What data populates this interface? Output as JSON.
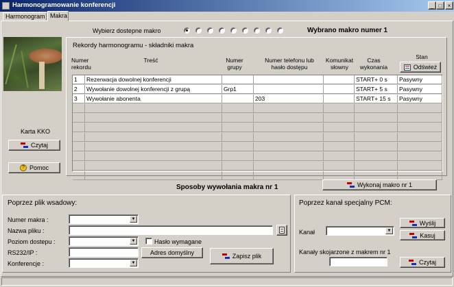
{
  "window": {
    "title": "Harmonogramowanie konferencji"
  },
  "tabs": [
    {
      "label": "Harmonogram"
    },
    {
      "label": "Makra"
    }
  ],
  "macro_select": {
    "label": "Wybierz dostepne makro",
    "radio_count": 9,
    "selected_index": 0,
    "status": "Wybrano makro numer 1"
  },
  "records": {
    "title": "Rekordy harmonogramu - składniki makra",
    "refresh_label": "Odśwież",
    "columns": {
      "num": "Numer rekordu",
      "content": "Treść",
      "group": "Numer grupy",
      "phone": "Numer telefonu lub hasło dostępu",
      "message": "Komunikat słowny",
      "time": "Czas wykonania",
      "state": "Stan"
    },
    "rows": [
      {
        "num": "1",
        "content": "Rezerwacja dowolnej konferencji",
        "group": "",
        "phone": "",
        "message": "",
        "time": "START+ 0 s",
        "state": "Pasywny"
      },
      {
        "num": "2",
        "content": "Wywołanie dowolnej konferencji z grupą",
        "group": "Grp1",
        "phone": "",
        "message": "",
        "time": "START+ 5 s",
        "state": "Pasywny"
      },
      {
        "num": "3",
        "content": "Wywołanie abonenta",
        "group": "",
        "phone": "203",
        "message": "",
        "time": "START+ 15 s",
        "state": "Pasywny"
      }
    ],
    "empty_rows": 8
  },
  "left": {
    "kko_label": "Karta KKO",
    "read_label": "Czytaj",
    "help_label": "Pomoc"
  },
  "methods_title": "Sposoby wywołania makra nr 1",
  "execute_label": "Wykonaj makro nr 1",
  "batch": {
    "title": "Poprzez plik wsadowy:",
    "macro_num_label": "Numer makra :",
    "file_label": "Nazwa pliku :",
    "access_label": "Poziom dostepu :",
    "password_label": "Hasło wymagane",
    "rs_label": "RS232/IP :",
    "default_addr_label": "Adres domyślny",
    "conf_label": "Konferencje :",
    "save_label": "Zapisz plik"
  },
  "pcm": {
    "title": "Poprzez kanał specjalny PCM:",
    "channel_label": "Kanał",
    "send_label": "Wyślij",
    "delete_label": "Kasuj",
    "linked_label": "Kanały skojarzone z makrem nr 1",
    "read_label": "Czytaj"
  },
  "colors": {
    "titlebar_start": "#0a246a",
    "titlebar_end": "#a6caf0",
    "face": "#d4d0c8"
  }
}
